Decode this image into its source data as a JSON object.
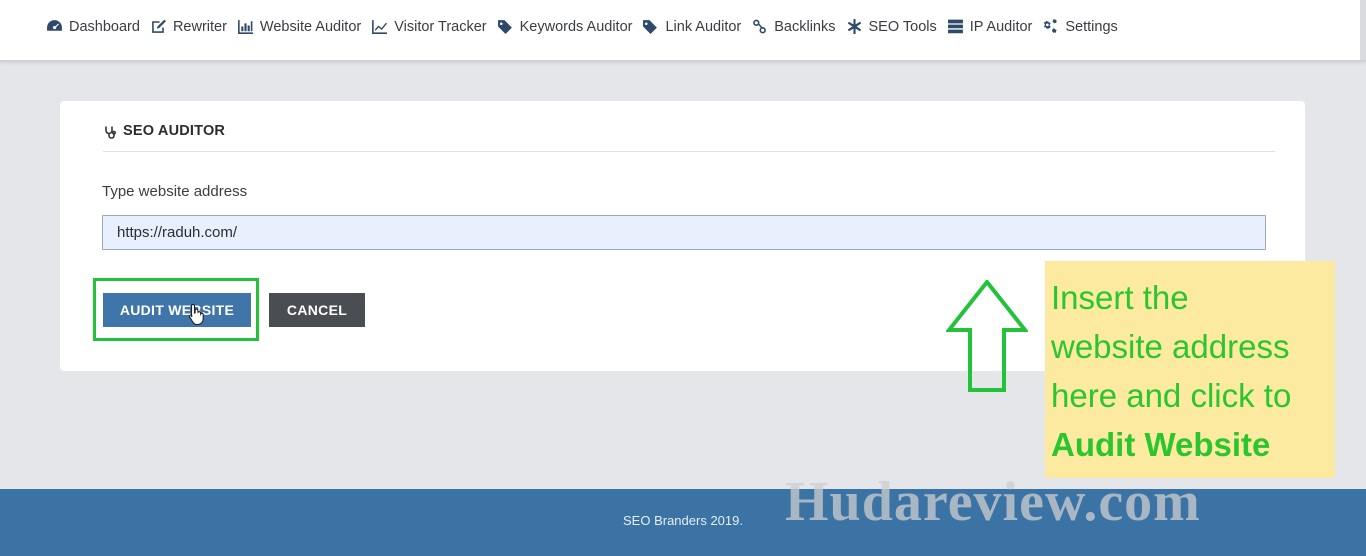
{
  "nav": {
    "items": [
      {
        "label": "Dashboard",
        "icon": "dashboard-icon"
      },
      {
        "label": "Rewriter",
        "icon": "edit-icon"
      },
      {
        "label": "Website Auditor",
        "icon": "bar-chart-icon"
      },
      {
        "label": "Visitor Tracker",
        "icon": "line-chart-icon"
      },
      {
        "label": "Keywords Auditor",
        "icon": "tags-icon"
      },
      {
        "label": "Link Auditor",
        "icon": "tag-icon"
      },
      {
        "label": "Backlinks",
        "icon": "link-icon"
      },
      {
        "label": "SEO Tools",
        "icon": "asterisk-icon"
      },
      {
        "label": "IP Auditor",
        "icon": "server-icon"
      },
      {
        "label": "Settings",
        "icon": "gears-icon"
      }
    ]
  },
  "card": {
    "title": "SEO AUDITOR",
    "field_label": "Type website address",
    "url_value": "https://raduh.com/",
    "audit_label": "AUDIT WEBSITE",
    "cancel_label": "CANCEL"
  },
  "annotation": {
    "line1": "Insert the",
    "line2": "website address",
    "line3": "here and click to",
    "line4": "Audit Website",
    "highlight_color": "#22c23a",
    "note_background": "#fbeaa0"
  },
  "footer": {
    "text": "SEO Branders 2019."
  },
  "watermark": "Hudareview.com",
  "colors": {
    "primary_button": "#3f75a8",
    "cancel_button": "#4a4d52",
    "footer": "#3a73a4"
  }
}
